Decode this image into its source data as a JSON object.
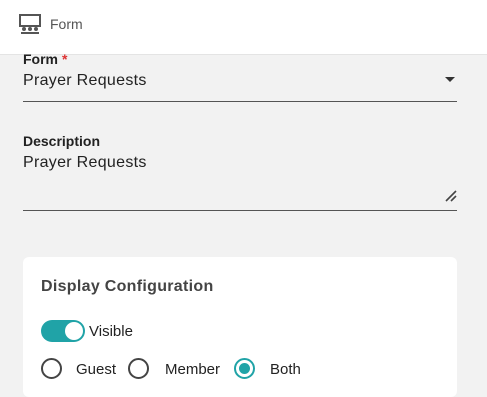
{
  "header": {
    "title": "Form",
    "icon": "presentation-audience-icon"
  },
  "form_field": {
    "label": "Form",
    "required_mark": "*",
    "value": "Prayer Requests"
  },
  "description_field": {
    "label": "Description",
    "value": "Prayer Requests"
  },
  "display_config": {
    "title": "Display Configuration",
    "visible_label": "Visible",
    "visible_on": true,
    "options": [
      {
        "label": "Guest",
        "checked": false
      },
      {
        "label": "Member",
        "checked": false
      },
      {
        "label": "Both",
        "checked": true
      }
    ]
  },
  "colors": {
    "accent": "#20a3a7"
  }
}
